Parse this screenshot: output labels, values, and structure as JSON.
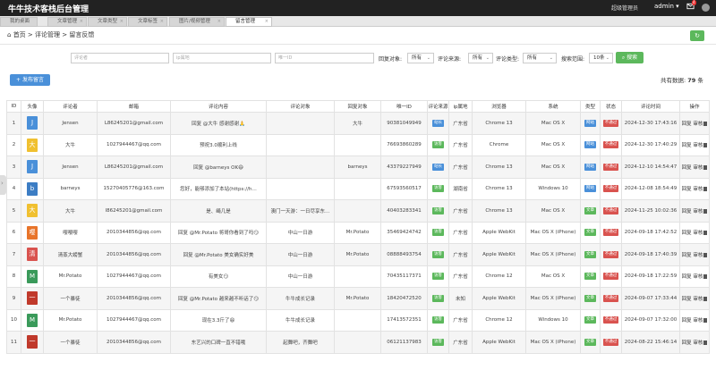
{
  "header": {
    "title": "牛牛技术客栈后台管理",
    "role": "超级管理员",
    "user": "admin",
    "notif": "4"
  },
  "tabs": [
    "我的桌面",
    "文章管理",
    "文章类型",
    "文章标签",
    "图片/视频管理",
    "留言管理"
  ],
  "breadcrumb": {
    "home": "首页",
    "sep1": ">",
    "c1": "评论管理",
    "sep2": ">",
    "c2": "留言反馈"
  },
  "filters": {
    "commenter": "评论者",
    "ip": "ip属地",
    "uid": "唯一ID",
    "reply_label": "回复对象:",
    "reply_val": "所有",
    "source_label": "评论来源:",
    "source_val": "所有",
    "type_label": "评论类型:",
    "type_val": "所有",
    "range_label": "搜索范围:",
    "range_val": "10条",
    "search": "搜索"
  },
  "post_button": "发布留言",
  "total": {
    "prefix": "共有数据:",
    "count": "79",
    "suffix": "条"
  },
  "columns": [
    "ID",
    "头像",
    "评论者",
    "邮箱",
    "评论内容",
    "评论对象",
    "回复对象",
    "唯一ID",
    "评论来源",
    "ip属地",
    "浏览器",
    "系统",
    "类型",
    "状态",
    "评论时间",
    "操作"
  ],
  "colors": {
    "blue": "#4a90d9",
    "green": "#5cb85c",
    "red": "#d9534f"
  },
  "actions": {
    "reply": "回复",
    "audit": "审核"
  },
  "rows": [
    {
      "id": "1",
      "av": "J",
      "avc": "#4a90d9",
      "name": "Jensen",
      "email": "L86245201@gmail.com",
      "content": "回复 @大牛 感谢感谢🙏",
      "target": "",
      "reply": "大牛",
      "uid": "90381049949",
      "src": "站长",
      "srcc": "#4a90d9",
      "ip": "广东省",
      "browser": "Chrome 13",
      "os": "Mac OS X",
      "type": "网站",
      "typec": "#4a90d9",
      "status": "不通过",
      "time": "2024-12-30 17:43:16"
    },
    {
      "id": "2",
      "av": "大",
      "avc": "#f0c030",
      "name": "大牛",
      "email": "1027944467@qq.com",
      "content": "预祝3.0顺利上线",
      "target": "",
      "reply": "",
      "uid": "76693860289",
      "src": "访客",
      "srcc": "#5cb85c",
      "ip": "广东省",
      "browser": "Chrome",
      "os": "Mac OS X",
      "type": "网站",
      "typec": "#4a90d9",
      "status": "不通过",
      "time": "2024-12-30 17:40:29"
    },
    {
      "id": "3",
      "av": "J",
      "avc": "#4a90d9",
      "name": "Jensen",
      "email": "L86245201@gmail.com",
      "content": "回复 @barneys OK😄",
      "target": "",
      "reply": "barneys",
      "uid": "43379227949",
      "src": "站长",
      "srcc": "#4a90d9",
      "ip": "广东省",
      "browser": "Chrome 13",
      "os": "Mac OS X",
      "type": "网站",
      "typec": "#4a90d9",
      "status": "不通过",
      "time": "2024-12-10 14:54:47"
    },
    {
      "id": "4",
      "av": "b",
      "avc": "#3c7dc4",
      "name": "barneys",
      "email": "15270405776@163.com",
      "content": "您好，能够添加了本站(https://h…",
      "target": "",
      "reply": "",
      "uid": "67593560517",
      "src": "访客",
      "srcc": "#5cb85c",
      "ip": "湖南省",
      "browser": "Chrome 13",
      "os": "Windows 10",
      "type": "网站",
      "typec": "#4a90d9",
      "status": "不通过",
      "time": "2024-12-08 18:54:49"
    },
    {
      "id": "5",
      "av": "大",
      "avc": "#f0c030",
      "name": "大牛",
      "email": "l86245201@gmail.com",
      "content": "是、绳几是",
      "target": "澳门一天游：一日尽享东…",
      "reply": "",
      "uid": "40403283341",
      "src": "访客",
      "srcc": "#5cb85c",
      "ip": "广东省",
      "browser": "Chrome 13",
      "os": "Mac OS X",
      "type": "文章",
      "typec": "#5cb85c",
      "status": "不通过",
      "time": "2024-11-25 10:02:36"
    },
    {
      "id": "6",
      "av": "嘤",
      "avc": "#e8742a",
      "name": "嘤嘤嘤",
      "email": "2010344856@qq.com",
      "content": "回复 @Mr.Potato 将哥你看到了吗😏",
      "target": "中山一日游",
      "reply": "Mr.Potato",
      "uid": "35469424742",
      "src": "访客",
      "srcc": "#5cb85c",
      "ip": "广东省",
      "browser": "Apple WebKit",
      "os": "Mac OS X (iPhone)",
      "type": "文章",
      "typec": "#5cb85c",
      "status": "不通过",
      "time": "2024-09-18 17:42:52"
    },
    {
      "id": "7",
      "av": "清",
      "avc": "#d9534f",
      "name": "清蒸大螃蟹",
      "email": "2010344856@qq.com",
      "content": "回复 @Mr.Potato 美女确实好美",
      "target": "中山一日游",
      "reply": "Mr.Potato",
      "uid": "08888493754",
      "src": "访客",
      "srcc": "#5cb85c",
      "ip": "广东省",
      "browser": "Apple WebKit",
      "os": "Mac OS X (iPhone)",
      "type": "文章",
      "typec": "#5cb85c",
      "status": "不通过",
      "time": "2024-09-18 17:40:39"
    },
    {
      "id": "8",
      "av": "M",
      "avc": "#3a9a5a",
      "name": "Mr.Potato",
      "email": "1027944467@qq.com",
      "content": "有美女😏",
      "target": "中山一日游",
      "reply": "",
      "uid": "70435117371",
      "src": "访客",
      "srcc": "#5cb85c",
      "ip": "广东省",
      "browser": "Chrome 12",
      "os": "Mac OS X",
      "type": "文章",
      "typec": "#5cb85c",
      "status": "不通过",
      "time": "2024-09-18 17:22:59"
    },
    {
      "id": "9",
      "av": "一",
      "avc": "#c0392b",
      "name": "一个暴徒",
      "email": "2010344856@qq.com",
      "content": "回复 @Mr.Potato 越来越不听话了😏",
      "target": "牛牛成长记录",
      "reply": "Mr.Potato",
      "uid": "18420472520",
      "src": "访客",
      "srcc": "#5cb85c",
      "ip": "未知",
      "browser": "Apple WebKit",
      "os": "Mac OS X (iPhone)",
      "type": "文章",
      "typec": "#5cb85c",
      "status": "不通过",
      "time": "2024-09-07 17:33:44"
    },
    {
      "id": "10",
      "av": "M",
      "avc": "#3a9a5a",
      "name": "Mr.Potato",
      "email": "1027944467@qq.com",
      "content": "现在3.3斤了😄",
      "target": "牛牛成长记录",
      "reply": "",
      "uid": "17413572351",
      "src": "访客",
      "srcc": "#5cb85c",
      "ip": "广东省",
      "browser": "Chrome 12",
      "os": "Windows 10",
      "type": "文章",
      "typec": "#5cb85c",
      "status": "不通过",
      "time": "2024-09-07 17:32:00"
    },
    {
      "id": "11",
      "av": "一",
      "avc": "#c0392b",
      "name": "一个暴徒",
      "email": "2010344856@qq.com",
      "content": "东艺兴的口碑一直不错哦",
      "target": "起舞吧，齐舞吧",
      "reply": "",
      "uid": "06121137983",
      "src": "访客",
      "srcc": "#5cb85c",
      "ip": "广东省",
      "browser": "Apple WebKit",
      "os": "Mac OS X (iPhone)",
      "type": "文章",
      "typec": "#5cb85c",
      "status": "不通过",
      "time": "2024-08-22 15:46:14"
    }
  ]
}
